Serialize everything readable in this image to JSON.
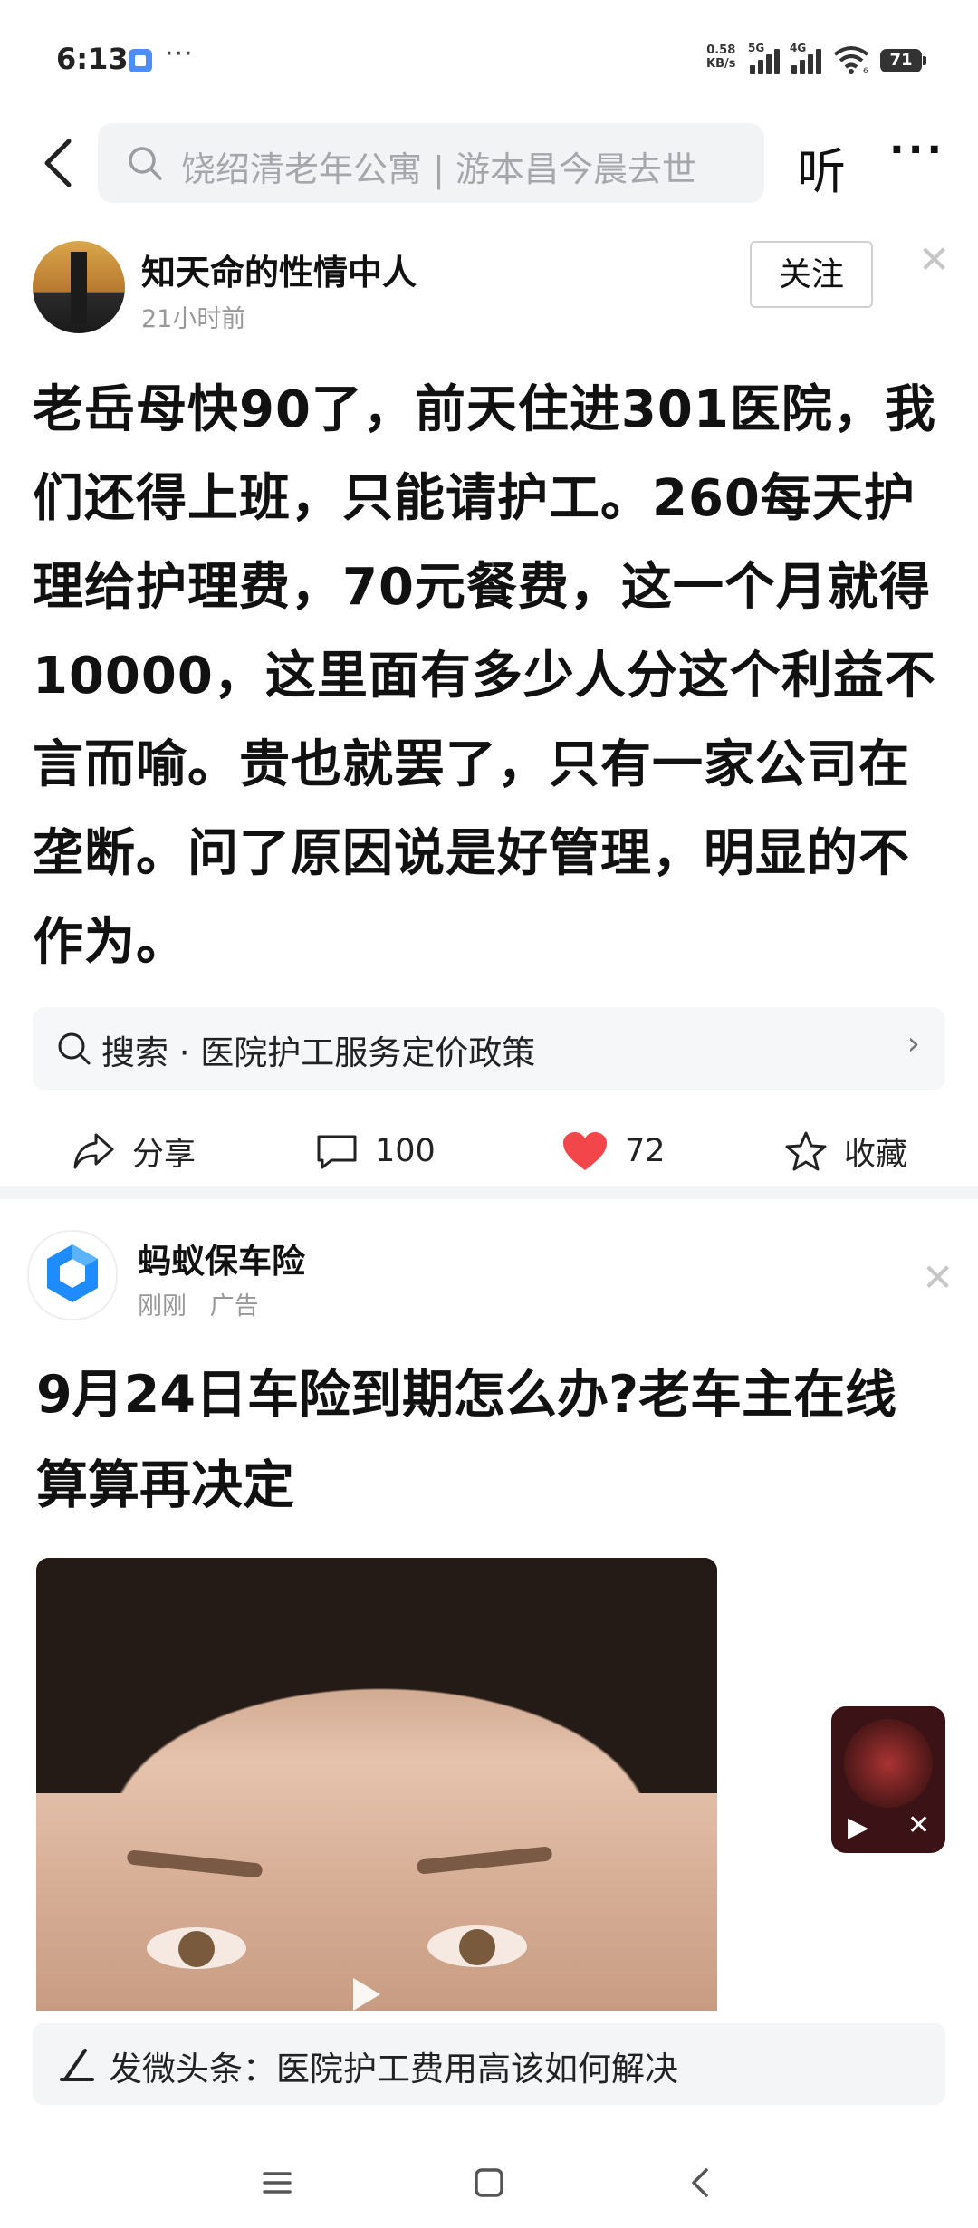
{
  "status_bar": {
    "time": "6:13",
    "more": "···",
    "net_speed_value": "0.58",
    "net_speed_unit": "KB/s",
    "sim1_label": "5G",
    "sim2_label": "4G",
    "wifi_sub": "6",
    "battery": "71"
  },
  "header": {
    "search_placeholder": "饶绍清老年公寓 | 游本昌今晨去世",
    "listen_label": "听",
    "more_label": "···"
  },
  "post": {
    "author": "知天命的性情中人",
    "time": "21小时前",
    "follow_label": "关注",
    "body": "老岳母快90了，前天住进301医院，我们还得上班，只能请护工。260每天护理给护理费，70元餐费，这一个月就得10000，这里面有多少人分这个利益不言而喻。贵也就罢了，只有一家公司在垄断。问了原因说是好管理，明显的不作为。",
    "search_suggestion": "搜索 · 医院护工服务定价政策",
    "actions": {
      "share_label": "分享",
      "comments": "100",
      "likes": "72",
      "favorite_label": "收藏"
    }
  },
  "ad": {
    "name": "蚂蚁保车险",
    "meta_time": "刚刚",
    "meta_tag": "广告",
    "title": "9月24日车险到期怎么办?老车主在线算算再决定"
  },
  "weitoutiao": {
    "text": "发微头条：医院护工费用高该如何解决"
  },
  "colors": {
    "like_red": "#f2464a",
    "accent_blue": "#1e8cff"
  }
}
